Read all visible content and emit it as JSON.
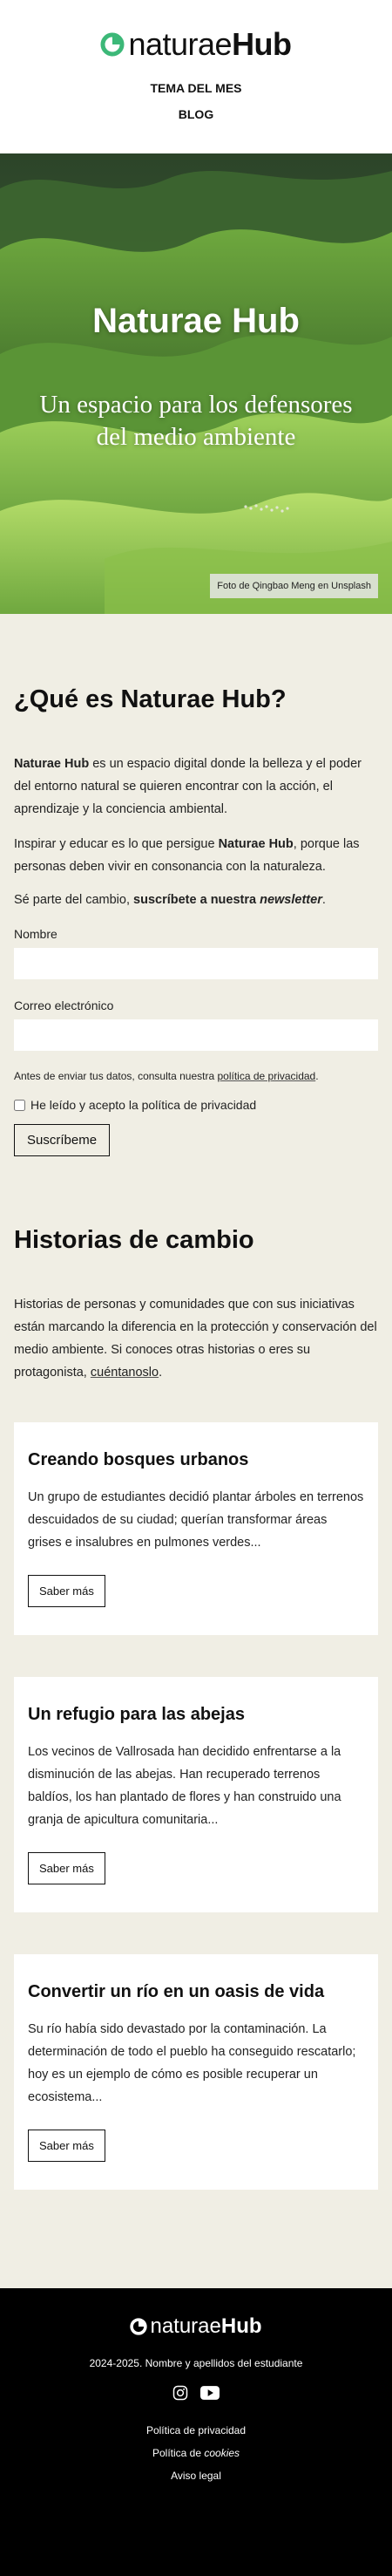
{
  "header": {
    "logo_light": "naturae",
    "logo_bold": "Hub",
    "nav": [
      "TEMA DEL MES",
      "BLOG"
    ]
  },
  "hero": {
    "title": "Naturae Hub",
    "subtitle": "Un espacio para los defensores del medio ambiente",
    "photo_credit": "Foto de Qingbao Meng en Unsplash"
  },
  "about": {
    "title": "¿Qué es Naturae Hub?",
    "p1_strong": "Naturae Hub",
    "p1_rest": " es un espacio digital donde la belleza y el poder del entorno natural se quieren encontrar con la acción, el aprendizaje y la conciencia ambiental.",
    "p2_start": "Inspirar y educar es lo que persigue ",
    "p2_strong": "Naturae Hub",
    "p2_end": ", porque las personas deben vivir en consonancia con la naturaleza.",
    "p3_start": "Sé parte del cambio, ",
    "p3_strong": "suscríbete a nuestra ",
    "p3_em": "newsletter",
    "p3_end": "."
  },
  "form": {
    "name_label": "Nombre",
    "email_label": "Correo electrónico",
    "privacy_text": "Antes de enviar tus datos, consulta nuestra ",
    "privacy_link": "política de privacidad",
    "privacy_end": ".",
    "checkbox_label": "He leído y acepto la política de privacidad",
    "submit_label": "Suscríbeme"
  },
  "stories": {
    "title": "Historias de cambio",
    "intro": "Historias de personas y comunidades que con sus iniciativas están marcando la diferencia en la protección y conservación del medio ambiente. Si conoces otras historias o eres su protagonista, ",
    "intro_link": "cuéntanoslo",
    "intro_end": ".",
    "cards": [
      {
        "title": "Creando bosques urbanos",
        "text": "Un grupo de estudiantes decidió plantar árboles en terrenos descuidados de su ciudad; querían transformar áreas grises e insalubres en pulmones verdes...",
        "button": "Saber más"
      },
      {
        "title": "Un refugio para las abejas",
        "text": "Los vecinos de Vallrosada han decidido enfrentarse a la disminución de las abejas. Han recuperado terrenos baldíos, los han plantado de flores y han construido una granja de apicultura comunitaria...",
        "button": "Saber más"
      },
      {
        "title": "Convertir un río en un oasis de vida",
        "text": "Su río había sido devastado por la contaminación. La determinación de todo el pueblo ha conseguido rescatarlo; hoy es un ejemplo de cómo es posible recuperar un ecosistema...",
        "button": "Saber más"
      }
    ]
  },
  "footer": {
    "logo_light": "naturae",
    "logo_bold": "Hub",
    "copyright": "2024-2025. Nombre y apellidos del estudiante",
    "links": [
      "Política de privacidad",
      "Política de ",
      "Aviso legal"
    ],
    "cookies_em": "cookies",
    "social_icons": [
      "instagram-icon",
      "youtube-icon"
    ]
  },
  "colors": {
    "accent": "#3cb878",
    "page_bg": "#f0eee4",
    "footer_bg": "#000000"
  }
}
